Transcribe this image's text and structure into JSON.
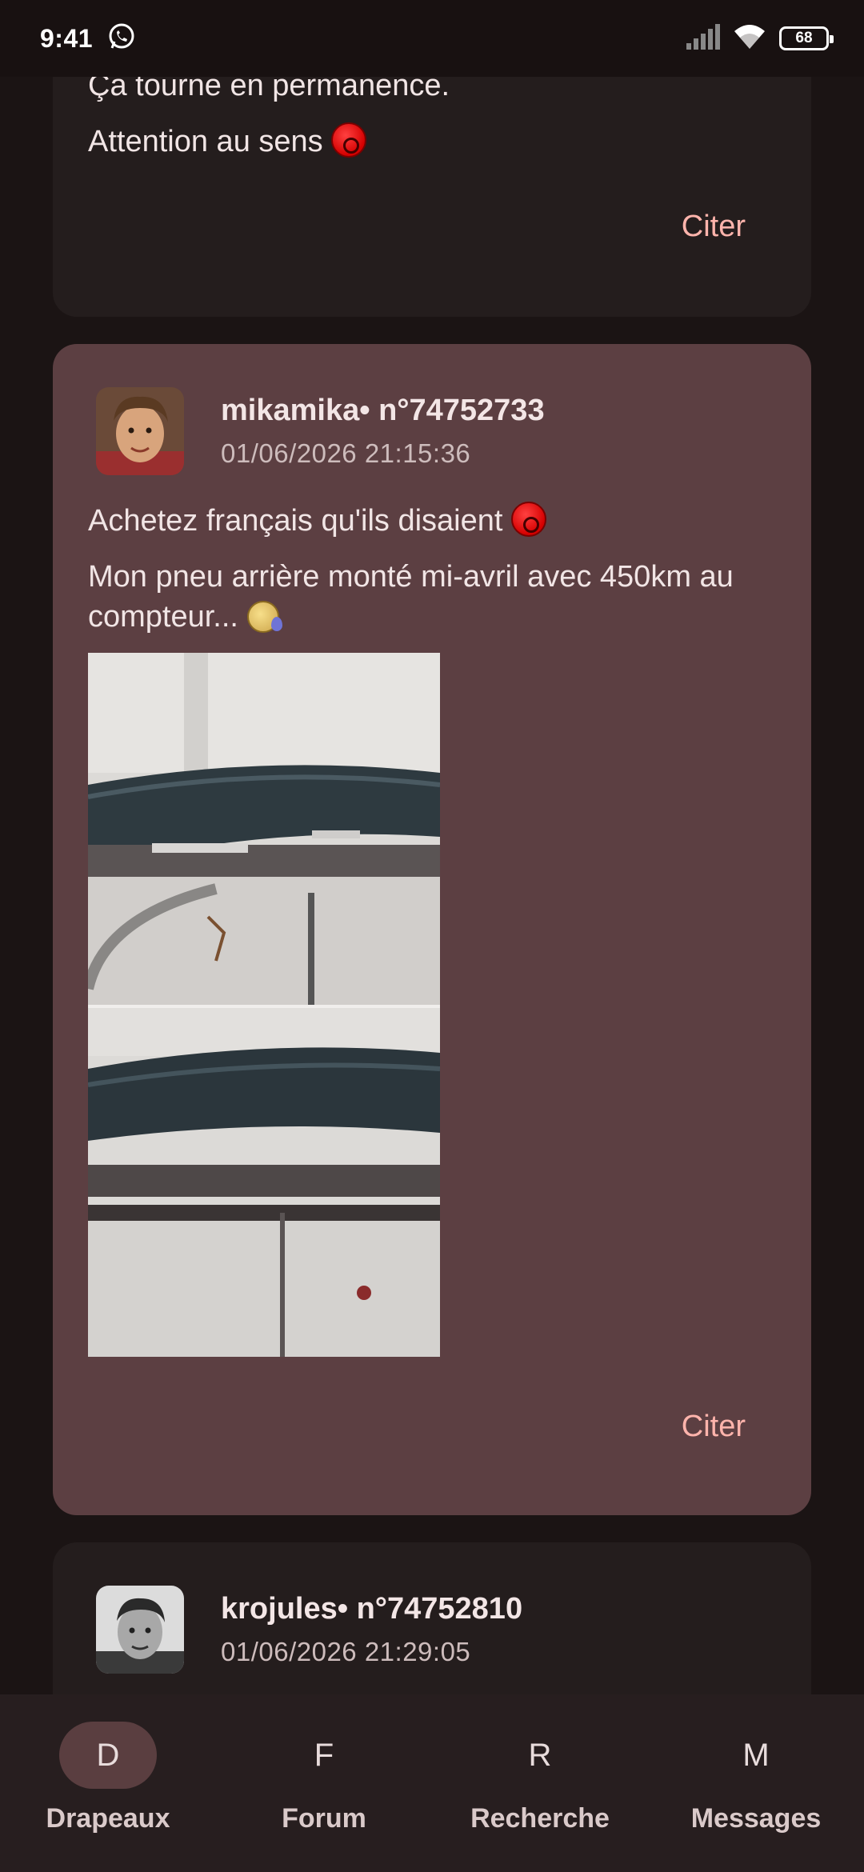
{
  "status_bar": {
    "time": "9:41",
    "battery": "68"
  },
  "posts": [
    {
      "lines": [
        "Ça tourne en permanence.",
        "Attention au sens"
      ],
      "cite_label": "Citer"
    },
    {
      "author": "mikamika",
      "post_number": "• n°74752733",
      "date": "01/06/2026 21:15:36",
      "line1": "Achetez français qu'ils disaient",
      "line2": "Mon pneu arrière monté mi-avril avec 450km au compteur...",
      "cite_label": "Citer"
    },
    {
      "author": "krojules",
      "post_number": "• n°74752810",
      "date": "01/06/2026 21:29:05"
    }
  ],
  "nav": [
    {
      "icon": "D",
      "label": "Drapeaux",
      "active": true
    },
    {
      "icon": "F",
      "label": "Forum"
    },
    {
      "icon": "R",
      "label": "Recherche"
    },
    {
      "icon": "M",
      "label": "Messages"
    }
  ],
  "colors": {
    "background": "#1b1414",
    "card": "#241d1d",
    "card_highlight": "#5c3f42",
    "accent": "#ffb4ac"
  }
}
